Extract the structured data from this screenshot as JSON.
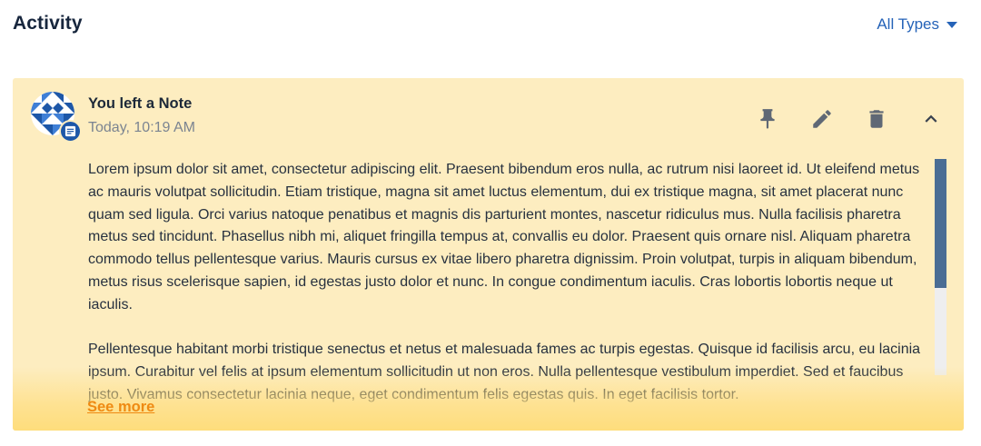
{
  "header": {
    "title": "Activity",
    "filter_label": "All Types"
  },
  "activity": {
    "author_line": "You left a Note",
    "timestamp": "Today, 10:19 AM",
    "paragraphs": [
      "Lorem ipsum dolor sit amet, consectetur adipiscing elit. Praesent bibendum eros nulla, ac rutrum nisi laoreet id. Ut eleifend metus ac mauris volutpat sollicitudin. Etiam tristique, magna sit amet luctus elementum, dui ex tristique magna, sit amet placerat nunc quam sed ligula. Orci varius natoque penatibus et magnis dis parturient montes, nascetur ridiculus mus. Nulla facilisis pharetra metus sed tincidunt. Phasellus nibh mi, aliquet fringilla tempus at, convallis eu dolor. Praesent quis ornare nisl. Aliquam pharetra commodo tellus pellentesque varius. Mauris cursus ex vitae libero pharetra dignissim. Proin volutpat, turpis in aliquam bibendum, metus risus scelerisque sapien, id egestas justo dolor et nunc. In congue condimentum iaculis. Cras lobortis lobortis neque ut iaculis.",
      "Pellentesque habitant morbi tristique senectus et netus et malesuada fames ac turpis egestas. Quisque id facilisis arcu, eu lacinia ipsum. Curabitur vel felis at ipsum elementum sollicitudin ut non eros. Nulla pellentesque vestibulum imperdiet. Sed et faucibus justo. Vivamus consectetur lacinia neque, eget condimentum felis egestas quis. In eget facilisis tortor."
    ],
    "see_more_label": "See more",
    "icons": {
      "avatar": "geometric-avatar-icon",
      "badge": "note-icon",
      "pin": "pin-icon",
      "edit": "pencil-icon",
      "delete": "trash-icon",
      "collapse": "chevron-up-icon"
    }
  },
  "colors": {
    "card_background": "#fdedc0",
    "accent_blue": "#2563b8",
    "see_more_orange": "#ef8a12",
    "scroll_thumb": "#4a6d94"
  }
}
